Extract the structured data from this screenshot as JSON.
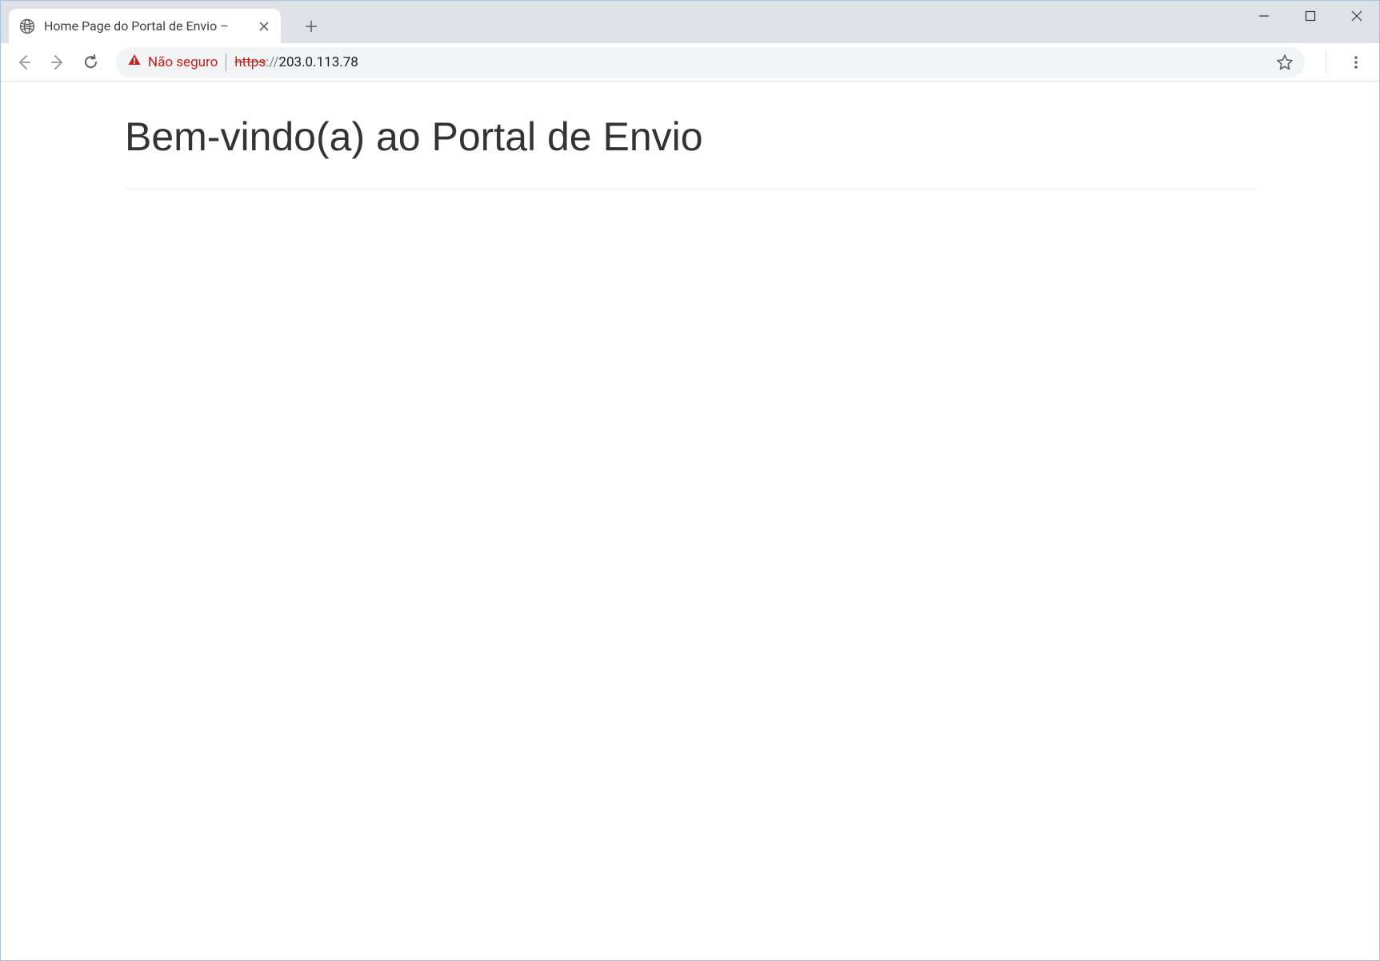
{
  "tab": {
    "title": "Home Page do Portal de Envio –"
  },
  "address": {
    "security_label": "Não seguro",
    "protocol": "https",
    "slashes": "://",
    "host": "203.0.113.78"
  },
  "page": {
    "heading": "Bem-vindo(a) ao Portal de Envio"
  }
}
